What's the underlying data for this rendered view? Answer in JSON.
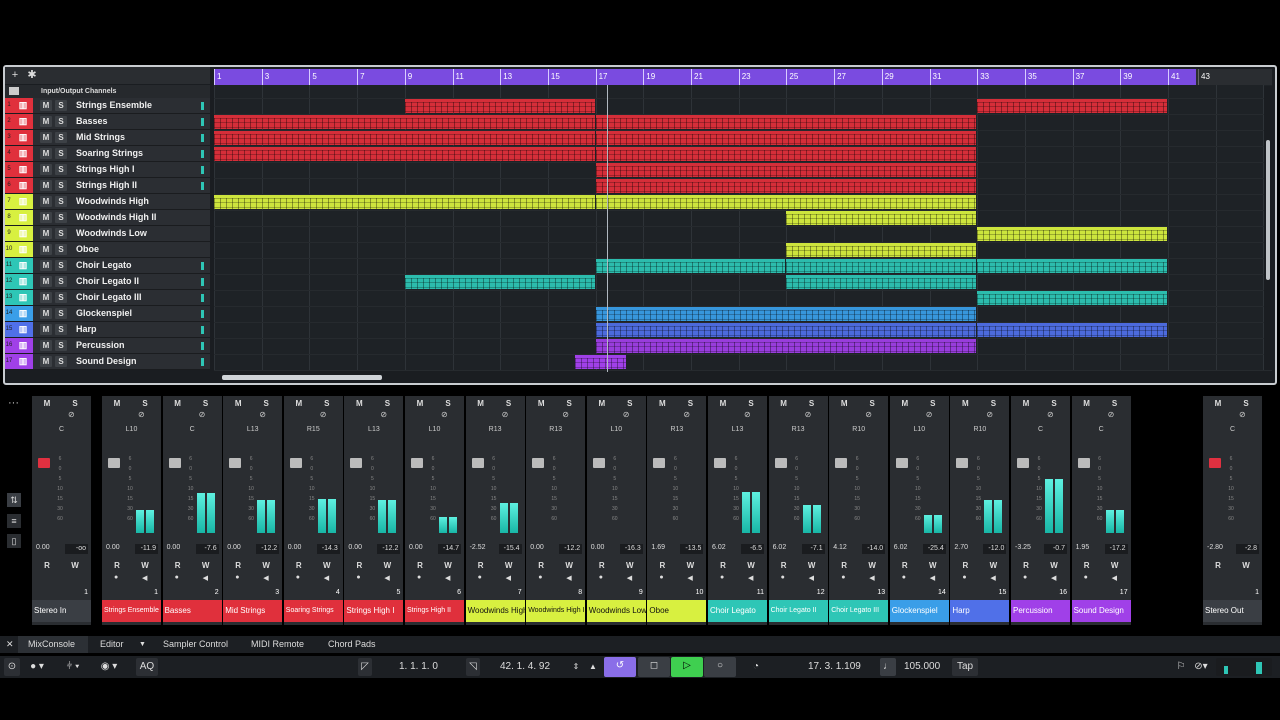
{
  "header": {
    "io_label": "Input/Output Channels",
    "add_icon": "plus-icon",
    "settings_icon": "gear-icon"
  },
  "tracks": [
    {
      "num": "1",
      "name": "Strings Ensemble",
      "color": "#e0303c"
    },
    {
      "num": "2",
      "name": "Basses",
      "color": "#e0303c"
    },
    {
      "num": "3",
      "name": "Mid Strings",
      "color": "#e0303c"
    },
    {
      "num": "4",
      "name": "Soaring Strings",
      "color": "#e0303c"
    },
    {
      "num": "5",
      "name": "Strings High I",
      "color": "#e0303c"
    },
    {
      "num": "6",
      "name": "Strings High II",
      "color": "#e0303c"
    },
    {
      "num": "7",
      "name": "Woodwinds High",
      "color": "#d8f040"
    },
    {
      "num": "8",
      "name": "Woodwinds High II",
      "color": "#d8f040"
    },
    {
      "num": "9",
      "name": "Woodwinds Low",
      "color": "#d8f040"
    },
    {
      "num": "10",
      "name": "Oboe",
      "color": "#d8f040"
    },
    {
      "num": "11",
      "name": "Choir Legato",
      "color": "#2ec6b6"
    },
    {
      "num": "12",
      "name": "Choir Legato II",
      "color": "#2ec6b6"
    },
    {
      "num": "13",
      "name": "Choir Legato III",
      "color": "#2ec6b6"
    },
    {
      "num": "14",
      "name": "Glockenspiel",
      "color": "#3a9ee8"
    },
    {
      "num": "15",
      "name": "Harp",
      "color": "#5070e8"
    },
    {
      "num": "16",
      "name": "Percussion",
      "color": "#a040e8"
    },
    {
      "num": "17",
      "name": "Sound Design",
      "color": "#a040e8"
    }
  ],
  "ruler": [
    "1",
    "3",
    "5",
    "7",
    "9",
    "11",
    "13",
    "15",
    "17",
    "19",
    "21",
    "23",
    "25",
    "27",
    "29",
    "31",
    "33",
    "35",
    "37",
    "39",
    "41",
    "43"
  ],
  "mixer": {
    "input": {
      "name": "Stereo In",
      "pan": "C",
      "vol": "0.00",
      "peak": "-oo",
      "num": "1"
    },
    "channels": [
      {
        "name": "Strings Ensemble",
        "pan": "L10",
        "vol": "0.00",
        "peak": "-11.9",
        "num": "1",
        "color": "#e0303c",
        "level": 0.35
      },
      {
        "name": "Basses",
        "pan": "C",
        "vol": "0.00",
        "peak": "-7.6",
        "num": "2",
        "color": "#e0303c",
        "level": 0.6
      },
      {
        "name": "Mid Strings",
        "pan": "L13",
        "vol": "0.00",
        "peak": "-12.2",
        "num": "3",
        "color": "#e0303c",
        "level": 0.5
      },
      {
        "name": "Soaring Strings",
        "pan": "R15",
        "vol": "0.00",
        "peak": "-14.3",
        "num": "4",
        "color": "#e0303c",
        "level": 0.52
      },
      {
        "name": "Strings High I",
        "pan": "L13",
        "vol": "0.00",
        "peak": "-12.2",
        "num": "5",
        "color": "#e0303c",
        "level": 0.5
      },
      {
        "name": "Strings High II",
        "pan": "L10",
        "vol": "0.00",
        "peak": "-14.7",
        "num": "6",
        "color": "#e0303c",
        "level": 0.25
      },
      {
        "name": "Woodwinds High",
        "pan": "R13",
        "vol": "-2.52",
        "peak": "-15.4",
        "num": "7",
        "color": "#d8f040",
        "level": 0.46
      },
      {
        "name": "Woodwinds High II",
        "pan": "R13",
        "vol": "0.00",
        "peak": "-12.2",
        "num": "8",
        "color": "#d8f040",
        "level": 0.0
      },
      {
        "name": "Woodwinds Low",
        "pan": "L10",
        "vol": "0.00",
        "peak": "-16.3",
        "num": "9",
        "color": "#d8f040",
        "level": 0.0
      },
      {
        "name": "Oboe",
        "pan": "R13",
        "vol": "1.69",
        "peak": "-13.5",
        "num": "10",
        "color": "#d8f040",
        "level": 0.0
      },
      {
        "name": "Choir Legato",
        "pan": "L13",
        "vol": "6.02",
        "peak": "-6.5",
        "num": "11",
        "color": "#2ec6b6",
        "level": 0.62
      },
      {
        "name": "Choir Legato II",
        "pan": "R13",
        "vol": "6.02",
        "peak": "-7.1",
        "num": "12",
        "color": "#2ec6b6",
        "level": 0.42
      },
      {
        "name": "Choir Legato III",
        "pan": "R10",
        "vol": "4.12",
        "peak": "-14.0",
        "num": "13",
        "color": "#2ec6b6",
        "level": 0.0
      },
      {
        "name": "Glockenspiel",
        "pan": "L10",
        "vol": "6.02",
        "peak": "-25.4",
        "num": "14",
        "color": "#3a9ee8",
        "level": 0.28
      },
      {
        "name": "Harp",
        "pan": "R10",
        "vol": "2.70",
        "peak": "-12.0",
        "num": "15",
        "color": "#5070e8",
        "level": 0.5
      },
      {
        "name": "Percussion",
        "pan": "C",
        "vol": "-3.25",
        "peak": "-0.7",
        "num": "16",
        "color": "#a040e8",
        "level": 0.82
      },
      {
        "name": "Sound Design",
        "pan": "C",
        "vol": "1.95",
        "peak": "-17.2",
        "num": "17",
        "color": "#a040e8",
        "level": 0.35
      }
    ],
    "output": {
      "name": "Stereo Out",
      "pan": "C",
      "vol": "-2.80",
      "peak": "-2.8",
      "num": "1"
    }
  },
  "buttons": {
    "m": "M",
    "s": "S",
    "r": "R",
    "w": "W"
  },
  "tabs": [
    "MixConsole",
    "Editor",
    "Sampler Control",
    "MIDI Remote",
    "Chord Pads"
  ],
  "transport": {
    "left_locator": "1. 1. 1.   0",
    "right_locator": "42. 1. 4. 92",
    "position": "17. 3. 1.109",
    "tempo": "105.000",
    "tap": "Tap",
    "aq": "AQ"
  }
}
